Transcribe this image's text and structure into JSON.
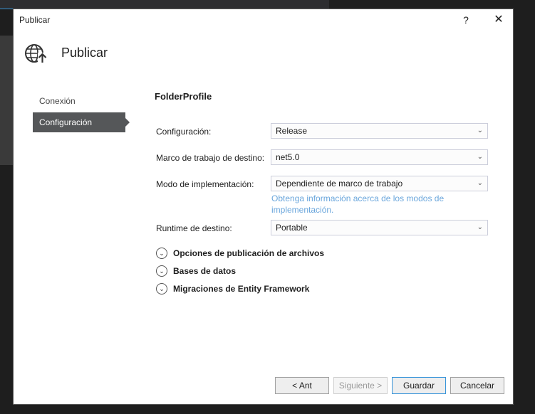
{
  "dialog": {
    "title": "Publicar",
    "help_label": "?",
    "close_label": "✕"
  },
  "header": {
    "title": "Publicar",
    "icon": "globe-publish-icon"
  },
  "nav": {
    "items": [
      {
        "label": "Conexión",
        "active": false
      },
      {
        "label": "Configuración",
        "active": true
      }
    ]
  },
  "profile": {
    "name": "FolderProfile"
  },
  "settings": {
    "configuracion": {
      "label": "Configuración:",
      "value": "Release"
    },
    "marco": {
      "label": "Marco de trabajo de destino:",
      "value": "net5.0"
    },
    "modo": {
      "label": "Modo de implementación:",
      "value": "Dependiente de marco de trabajo"
    },
    "runtime": {
      "label": "Runtime de destino:",
      "value": "Portable"
    },
    "info_link": "Obtenga información acerca de los modos de implementación."
  },
  "sections": [
    {
      "label": "Opciones de publicación de archivos"
    },
    {
      "label": "Bases de datos"
    },
    {
      "label": "Migraciones de Entity Framework"
    }
  ],
  "footer": {
    "back_label": "< Ant",
    "next_label": "Siguiente >",
    "save_label": "Guardar",
    "cancel_label": "Cancelar"
  },
  "colors": {
    "accent": "#3794d9",
    "nav_active": "#555759",
    "link": "#6aa6dc"
  }
}
